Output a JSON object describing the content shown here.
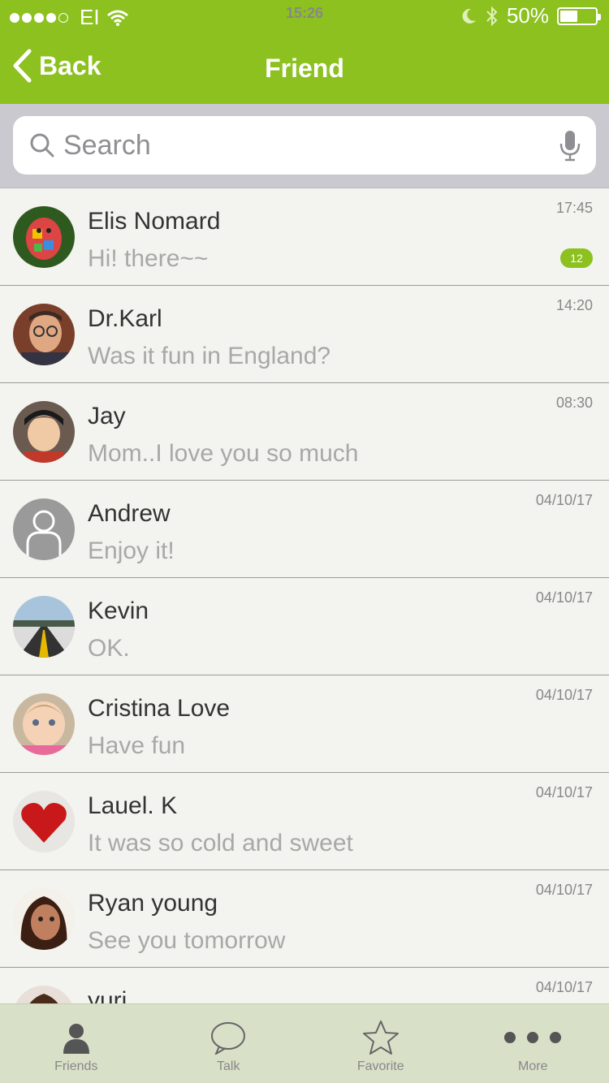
{
  "status_bar": {
    "carrier": "EI",
    "time": "15:26",
    "battery": "50%",
    "battery_level": 0.5
  },
  "nav": {
    "back_label": "Back",
    "title": "Friend"
  },
  "search": {
    "placeholder": "Search"
  },
  "chats": [
    {
      "name": "Elis Nomard",
      "message": "Hi! there~~",
      "time": "17:45",
      "badge": "12",
      "avatar": "toy-elephant"
    },
    {
      "name": "Dr.Karl",
      "message": "Was it fun in England?",
      "time": "14:20",
      "badge": "",
      "avatar": "man-glasses"
    },
    {
      "name": "Jay",
      "message": "Mom..I love you so much",
      "time": "08:30",
      "badge": "",
      "avatar": "boy"
    },
    {
      "name": "Andrew",
      "message": "Enjoy it!",
      "time": "04/10/17",
      "badge": "",
      "avatar": "default-user"
    },
    {
      "name": "Kevin",
      "message": "OK.",
      "time": "04/10/17",
      "badge": "",
      "avatar": "road"
    },
    {
      "name": "Cristina Love",
      "message": "Have fun",
      "time": "04/10/17",
      "badge": "",
      "avatar": "baby"
    },
    {
      "name": "Lauel. K",
      "message": "It was so cold and sweet",
      "time": "04/10/17",
      "badge": "",
      "avatar": "red-heart"
    },
    {
      "name": "Ryan young",
      "message": "See you tomorrow",
      "time": "04/10/17",
      "badge": "",
      "avatar": "woman"
    },
    {
      "name": "yuri",
      "message": "",
      "time": "04/10/17",
      "badge": "",
      "avatar": "person"
    }
  ],
  "tabs": [
    {
      "label": "Friends",
      "icon": "person-icon"
    },
    {
      "label": "Talk",
      "icon": "chat-bubble-icon"
    },
    {
      "label": "Favorite",
      "icon": "star-icon"
    },
    {
      "label": "More",
      "icon": "more-icon"
    }
  ],
  "colors": {
    "accent": "#8cc11f",
    "tabbar": "#d8e0c8"
  }
}
